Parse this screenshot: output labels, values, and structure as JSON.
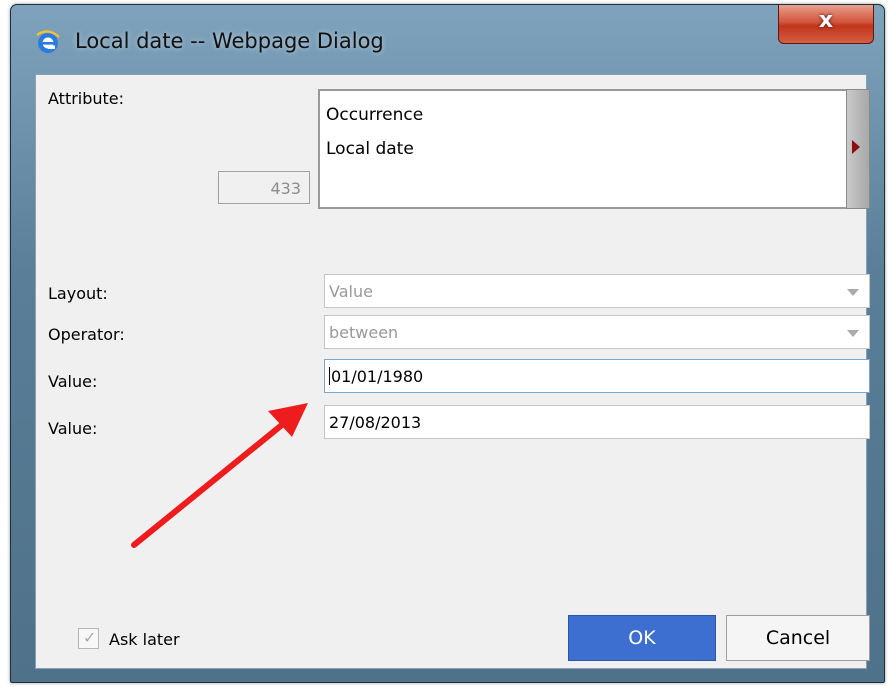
{
  "window": {
    "title": "Local date -- Webpage Dialog",
    "close_label": "x"
  },
  "attribute": {
    "label": "Attribute:",
    "id_value": "433",
    "lines": [
      "Occurrence",
      "Local date"
    ]
  },
  "layout": {
    "label": "Layout:",
    "value": "Value"
  },
  "operator": {
    "label": "Operator:",
    "value": "between"
  },
  "value1": {
    "label": "Value:",
    "value": "01/01/1980"
  },
  "value2": {
    "label": "Value:",
    "value": "27/08/2013"
  },
  "ask_later": {
    "label": "Ask later",
    "checked": true
  },
  "buttons": {
    "ok": "OK",
    "cancel": "Cancel"
  },
  "colors": {
    "ok_button": "#3d6fd1",
    "annotation_arrow": "#ee1c1c"
  }
}
